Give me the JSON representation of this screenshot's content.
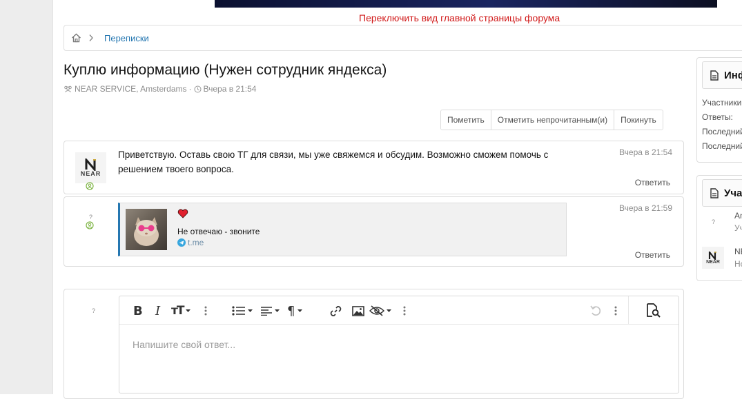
{
  "banner": {
    "switch_link": "Переключить вид главной страницы форума"
  },
  "breadcrumb": {
    "item": "Переписки"
  },
  "thread": {
    "title": "Куплю информацию (Нужен сотрудник яндекса)",
    "participants": "NEAR SERVICE, Amsterdams",
    "separator": "·",
    "date": "Вчера в 21:54"
  },
  "actions": {
    "mark": "Пометить",
    "mark_unread": "Отметить непрочитанным(и)",
    "leave": "Покинуть"
  },
  "messages": [
    {
      "avatar_text": "NEAR",
      "text": "Приветствую. Оставь свою ТГ для связи, мы уже свяжемся и обсудим. Возможно сможем помочь с решением твоего вопроса.",
      "time": "Вчера в 21:54",
      "reply": "Ответить"
    },
    {
      "avatar_text": "?",
      "embed": {
        "title": "Не отвечаю - звоните",
        "domain": "t.me"
      },
      "time": "Вчера в 21:59",
      "reply": "Ответить"
    }
  ],
  "editor": {
    "avatar_text": "?",
    "placeholder": "Напишите свой ответ..."
  },
  "sidebar": {
    "info": {
      "title": "Информация",
      "rows": [
        "Участники:",
        "Ответы:",
        "Последний:",
        "Последний:"
      ]
    },
    "participants": {
      "title": "Участники",
      "users": [
        {
          "avatar": "?",
          "name": "Amsterdams",
          "sub": "Участник"
        },
        {
          "avatar": "NEAR",
          "name": "NEAR SERVICE",
          "sub": "Новичок"
        }
      ]
    }
  },
  "colors": {
    "link": "#2577b1",
    "accent_red": "#d11a1a",
    "online": "#7cb342",
    "border": "#dcdcdc"
  }
}
